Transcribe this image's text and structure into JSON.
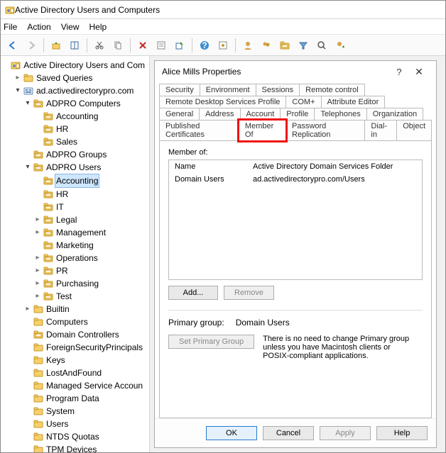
{
  "window": {
    "title": "Active Directory Users and Computers"
  },
  "menu": {
    "file": "File",
    "action": "Action",
    "view": "View",
    "help": "Help"
  },
  "toolbar_icons": [
    "back-icon",
    "forward-icon",
    "up-icon",
    "show-hide-icon",
    "cut-icon",
    "copy-icon",
    "delete-icon",
    "properties-icon",
    "export-icon",
    "refresh-icon",
    "help-icon",
    "action-icon",
    "user-icon",
    "group-icon",
    "ou-icon",
    "filter-icon",
    "find-icon",
    "add-user-icon"
  ],
  "tree": {
    "root": {
      "label": "Active Directory Users and Com",
      "icon": "aduc"
    },
    "saved_queries": {
      "label": "Saved Queries",
      "icon": "folder"
    },
    "domain": {
      "label": "ad.activedirectorypro.com",
      "icon": "domain"
    },
    "items": [
      {
        "label": "ADPRO Computers",
        "expanded": true,
        "icon": "ou",
        "children": [
          {
            "label": "Accounting",
            "icon": "ou"
          },
          {
            "label": "HR",
            "icon": "ou"
          },
          {
            "label": "Sales",
            "icon": "ou"
          }
        ]
      },
      {
        "label": "ADPRO Groups",
        "expanded": false,
        "icon": "ou",
        "children": []
      },
      {
        "label": "ADPRO Users",
        "expanded": true,
        "icon": "ou",
        "children": [
          {
            "label": "Accounting",
            "icon": "ou",
            "selected": true
          },
          {
            "label": "HR",
            "icon": "ou"
          },
          {
            "label": "IT",
            "icon": "ou"
          },
          {
            "label": "Legal",
            "icon": "ou",
            "arrow": "closed"
          },
          {
            "label": "Management",
            "icon": "ou",
            "arrow": "closed"
          },
          {
            "label": "Marketing",
            "icon": "ou"
          },
          {
            "label": "Operations",
            "icon": "ou",
            "arrow": "closed"
          },
          {
            "label": "PR",
            "icon": "ou",
            "arrow": "closed"
          },
          {
            "label": "Purchasing",
            "icon": "ou",
            "arrow": "closed"
          },
          {
            "label": "Test",
            "icon": "ou",
            "arrow": "closed"
          }
        ]
      },
      {
        "label": "Builtin",
        "expanded": false,
        "icon": "folder",
        "arrow": "closed"
      },
      {
        "label": "Computers",
        "icon": "folder"
      },
      {
        "label": "Domain Controllers",
        "icon": "ou"
      },
      {
        "label": "ForeignSecurityPrincipals",
        "icon": "folder"
      },
      {
        "label": "Keys",
        "icon": "folder"
      },
      {
        "label": "LostAndFound",
        "icon": "folder"
      },
      {
        "label": "Managed Service Accoun",
        "icon": "folder"
      },
      {
        "label": "Program Data",
        "icon": "folder"
      },
      {
        "label": "System",
        "icon": "folder"
      },
      {
        "label": "Users",
        "icon": "folder"
      },
      {
        "label": "NTDS Quotas",
        "icon": "folder"
      },
      {
        "label": "TPM Devices",
        "icon": "folder"
      }
    ]
  },
  "dialog": {
    "title": "Alice Mills Properties",
    "tabs_row1": [
      "Security",
      "Environment",
      "Sessions",
      "Remote control"
    ],
    "tabs_row2": [
      "Remote Desktop Services Profile",
      "COM+",
      "Attribute Editor"
    ],
    "tabs_row3": [
      "General",
      "Address",
      "Account",
      "Profile",
      "Telephones",
      "Organization"
    ],
    "tabs_row4": [
      "Published Certificates",
      "Member Of",
      "Password Replication",
      "Dial-in",
      "Object"
    ],
    "active_tab": "Member Of",
    "member_of_label": "Member of:",
    "list": {
      "headers": [
        "Name",
        "Active Directory Domain Services Folder"
      ],
      "rows": [
        {
          "name": "Domain Users",
          "folder": "ad.activedirectorypro.com/Users"
        }
      ]
    },
    "add_btn": "Add...",
    "remove_btn": "Remove",
    "primary_group_label": "Primary group:",
    "primary_group_value": "Domain Users",
    "set_primary_btn": "Set Primary Group",
    "note": "There is no need to change Primary group unless you have Macintosh clients or POSIX-compliant applications.",
    "ok": "OK",
    "cancel": "Cancel",
    "apply": "Apply",
    "help": "Help"
  }
}
